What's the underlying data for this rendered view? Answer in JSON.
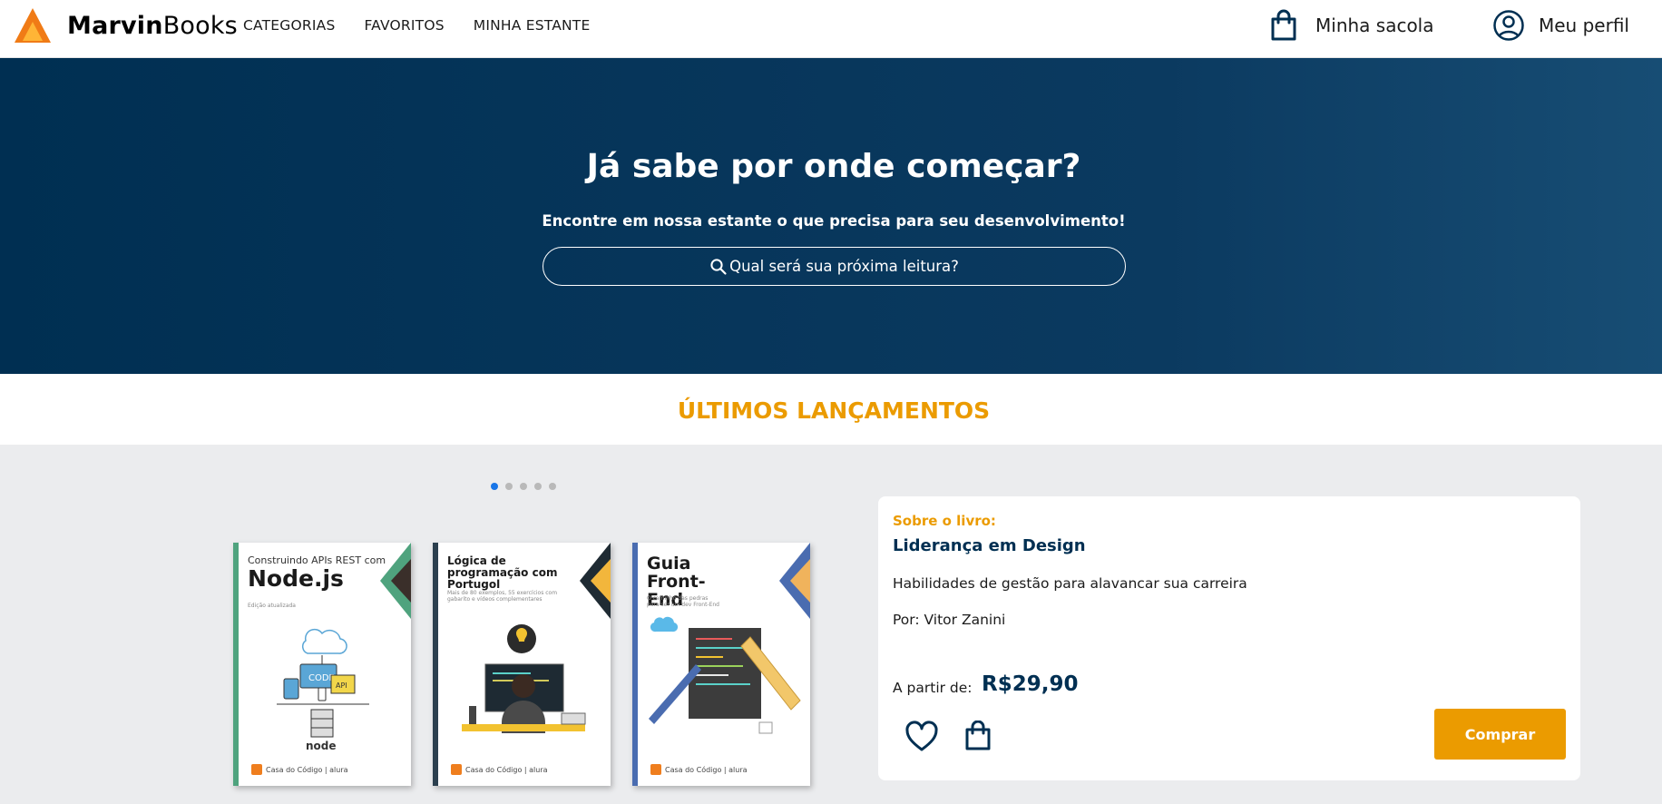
{
  "header": {
    "logo_text_bold": "Marvin",
    "logo_text_light": "Books",
    "nav": [
      {
        "label": "CATEGORIAS"
      },
      {
        "label": "FAVORITOS"
      },
      {
        "label": "MINHA ESTANTE"
      }
    ],
    "bag_label": "Minha sacola",
    "profile_label": "Meu perfil"
  },
  "hero": {
    "title": "Já sabe por onde começar?",
    "subtitle": "Encontre em nossa estante o que precisa para seu desenvolvimento!",
    "search_placeholder": "Qual será sua próxima leitura?"
  },
  "releases": {
    "title": "ÚLTIMOS LANÇAMENTOS",
    "carousel_pages": 5,
    "active_page": 1,
    "books": [
      {
        "title_small": "Construindo APIs REST com",
        "title_big": "Node.js",
        "note": "Edição atualizada",
        "spine_color": "#4fa37e",
        "accent_color": "#4fa37e",
        "footer": "Casa do Código | alura"
      },
      {
        "title_small": "Lógica de programação com Portugol",
        "title_big": "",
        "note": "Mais de 80 exemplos, 55 exercícios com gabarito e vídeos complementares",
        "spine_color": "#2b3f4e",
        "accent_color": "#f2b63c",
        "footer": "Casa do Código | alura"
      },
      {
        "title_small": "",
        "title_big": "Guia Front-End",
        "note": "O caminho das pedras para ser um dev Front-End",
        "spine_color": "#4a6cb0",
        "accent_color": "#f0b35c",
        "footer": "Casa do Código | alura"
      }
    ]
  },
  "details": {
    "about_label": "Sobre o livro:",
    "book_title": "Liderança em Design",
    "description": "Habilidades de gestão para alavancar sua carreira",
    "author": "Por: Vitor Zanini",
    "price_label": "A partir de:",
    "price": "R$29,90",
    "buy_label": "Comprar"
  },
  "colors": {
    "primary": "#002f52",
    "accent": "#eb9b00",
    "active_dot": "#1875e8"
  }
}
